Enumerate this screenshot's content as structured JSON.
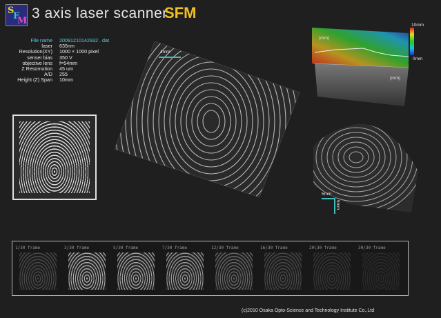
{
  "header": {
    "logo_letters": [
      "S",
      "F",
      "M"
    ],
    "title": "3 axis laser scanner",
    "brand": "SFM"
  },
  "info": [
    {
      "key": "File name",
      "value": "20091210142932 . dat"
    },
    {
      "key": "laser",
      "value": "635nm"
    },
    {
      "key": "Resolution(XY)",
      "value": "1000 ×  1000 pixel"
    },
    {
      "key": "senser bias",
      "value": "350 V"
    },
    {
      "key": "objective lens",
      "value": "f=54mm"
    },
    {
      "key": "Z Resomution",
      "value": "45 um"
    },
    {
      "key": "A/D",
      "value": "255"
    },
    {
      "key": "Height (Z) Span",
      "value": "10mm"
    }
  ],
  "scales": {
    "main": "4mm",
    "side_h": "5mm",
    "side_v": "5mm"
  },
  "colorbar": {
    "max": "10mm",
    "min": "0mm",
    "colors": [
      "#e02020",
      "#e0e020",
      "#20d020",
      "#20c0e0",
      "#2030d0"
    ]
  },
  "topo_axis": {
    "y_unit": "(mm)",
    "x_unit": "(mm)"
  },
  "frames": [
    {
      "label": "1/30 frame",
      "intensity": 0.25
    },
    {
      "label": "3/30 frame",
      "intensity": 0.75
    },
    {
      "label": "5/30 frame",
      "intensity": 0.7
    },
    {
      "label": "7/30 frame",
      "intensity": 0.65
    },
    {
      "label": "12/30 frame",
      "intensity": 0.4
    },
    {
      "label": "16/30 frame",
      "intensity": 0.25
    },
    {
      "label": "20\\30 frame",
      "intensity": 0.15
    },
    {
      "label": "30/30 frame",
      "intensity": 0.1
    }
  ],
  "copyright": "(c)2010 Osaka Opto-Science and Technology Institute Co.,Ltd"
}
